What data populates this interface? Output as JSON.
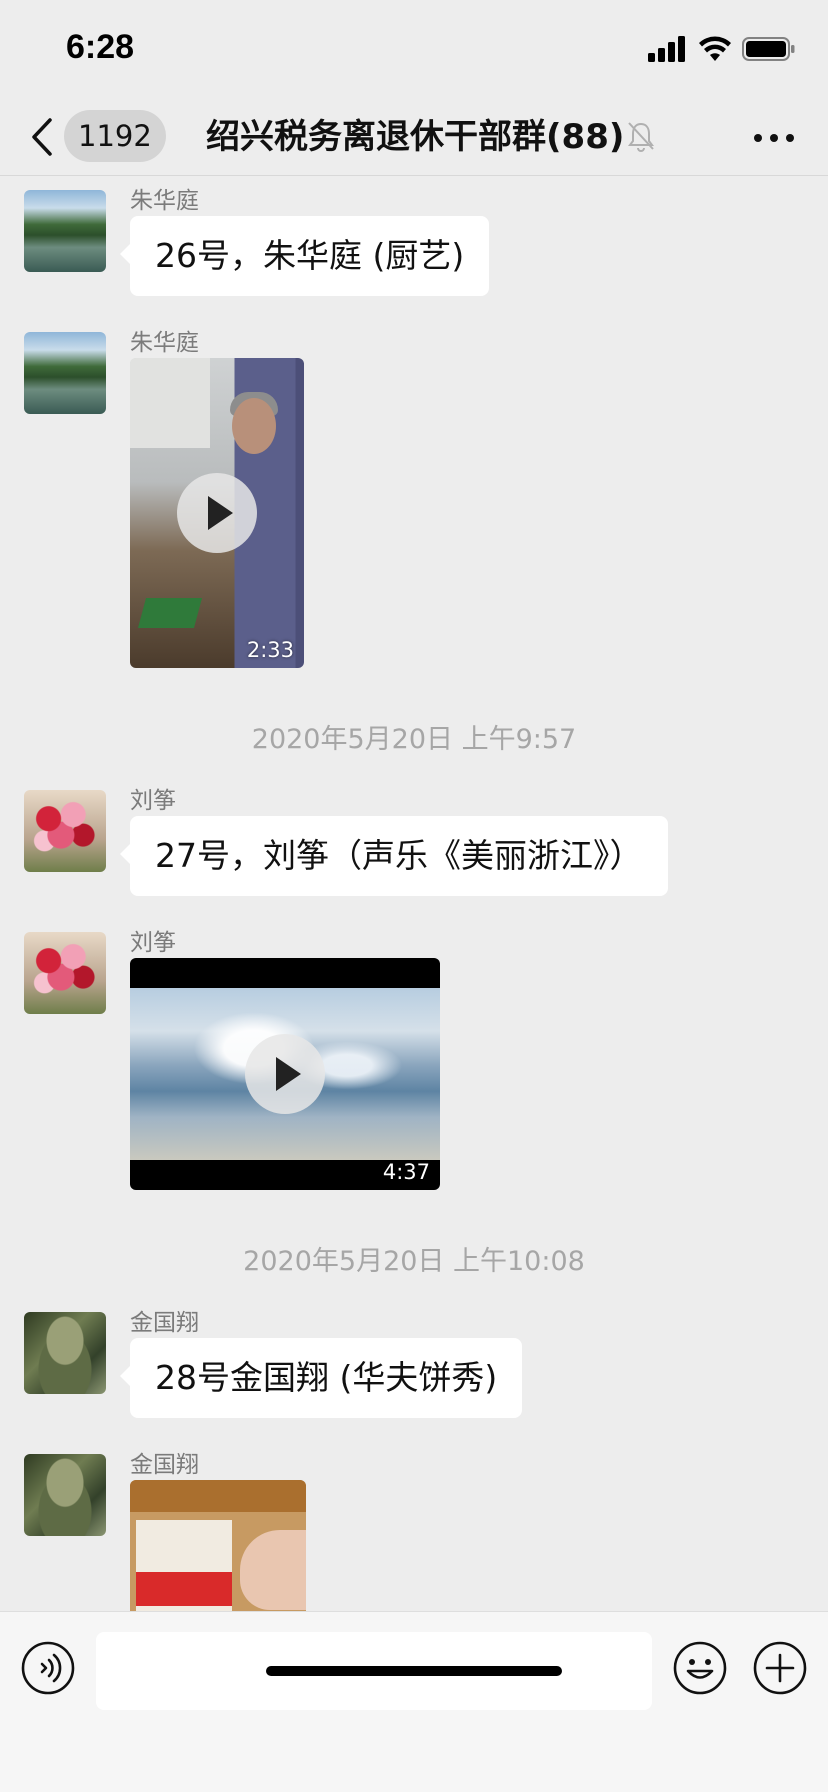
{
  "status_bar": {
    "time": "6:28"
  },
  "nav": {
    "unread_count": "1192",
    "title": "绍兴税务离退休干部群(88)"
  },
  "messages": [
    {
      "sender": "朱华庭",
      "type": "text",
      "text": "26号，朱华庭 (厨艺)"
    },
    {
      "sender": "朱华庭",
      "type": "video",
      "duration": "2:33"
    },
    {
      "type": "timestamp",
      "text": "2020年5月20日 上午9:57"
    },
    {
      "sender": "刘筝",
      "type": "text",
      "text": "27号，刘筝（声乐《美丽浙江》）"
    },
    {
      "sender": "刘筝",
      "type": "video",
      "duration": "4:37"
    },
    {
      "type": "timestamp",
      "text": "2020年5月20日 上午10:08"
    },
    {
      "sender": "金国翔",
      "type": "text",
      "text": "28号金国翔 (华夫饼秀)"
    },
    {
      "sender": "金国翔",
      "type": "video",
      "duration": ""
    }
  ],
  "icons": {
    "back": "chevron-left-icon",
    "mute": "bell-off-icon",
    "more": "more-horizontal-icon",
    "voice": "voice-icon",
    "emoji": "emoji-icon",
    "plus": "plus-icon"
  }
}
